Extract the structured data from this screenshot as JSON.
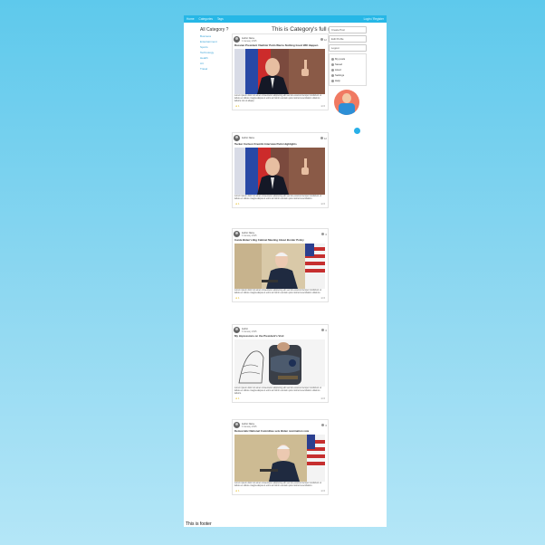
{
  "topbar": {
    "links": [
      "Home",
      "Categories",
      "Tags"
    ],
    "right": "Login / Register"
  },
  "sidebar": {
    "title": "All Category ?",
    "items": [
      "Business",
      "Entertainment",
      "Sports",
      "Technology",
      "Health",
      "Art",
      "Travel"
    ]
  },
  "page_title": "This is Category's full news $",
  "right_column": {
    "buttons": [
      "Create Post",
      "Edit Profile",
      "Logout"
    ],
    "links": [
      "My posts",
      "Saved",
      "Liked",
      "Settings",
      "Help"
    ]
  },
  "posts": [
    {
      "author": "Author Name",
      "date": "4 January 2025",
      "stat": "12",
      "title": "Russian President Vladimir Putin Warns Nothing Good Will Happen",
      "text": "Lorem ipsum dolor sit amet consectetur adipiscing elit sed do eiusmod tempor incididunt ut labore et dolore magna aliqua ut enim ad minim veniam quis nostrud exercitation ullamco laboris nisi ut aliquip.",
      "likes": "1",
      "comments": "0"
    },
    {
      "author": "Author Name",
      "date": "",
      "stat": "12",
      "title": "Tucker Carlson Kremlin Interview Putin Highlights",
      "text": "Lorem ipsum dolor sit amet consectetur adipiscing elit sed do eiusmod tempor incididunt ut labore et dolore magna aliqua ut enim ad minim veniam quis nostrud exercitation.",
      "likes": "1",
      "comments": "0"
    },
    {
      "author": "Author Name",
      "date": "4 January 2025",
      "stat": "0",
      "title": "Inside Biden's Big Cabinet Meeting About Border Policy",
      "text": "Lorem ipsum dolor sit amet consectetur adipiscing elit sed do eiusmod tempor incididunt ut labore et dolore magna aliqua ut enim ad minim veniam quis nostrud exercitation ullamco.",
      "likes": "1",
      "comments": "0"
    },
    {
      "author": "Author",
      "date": "4 January 2025",
      "stat": "0",
      "title": "My impressions on the President's Visit",
      "text": "Lorem ipsum dolor sit amet consectetur adipiscing elit sed do eiusmod tempor incididunt ut labore et dolore magna aliqua ut enim ad minim veniam quis nostrud exercitation ullamco laboris.",
      "likes": "1",
      "comments": "0"
    },
    {
      "author": "Author Name",
      "date": "4 January 2025",
      "stat": "0",
      "title": "Democratic National Committee sets Biden nomination vote",
      "text": "Lorem ipsum dolor sit amet consectetur adipiscing elit sed do eiusmod tempor incididunt ut labore et dolore magna aliqua ut enim ad minim veniam quis nostrud exercitation.",
      "likes": "1",
      "comments": "0"
    }
  ],
  "footer": "This is footer"
}
